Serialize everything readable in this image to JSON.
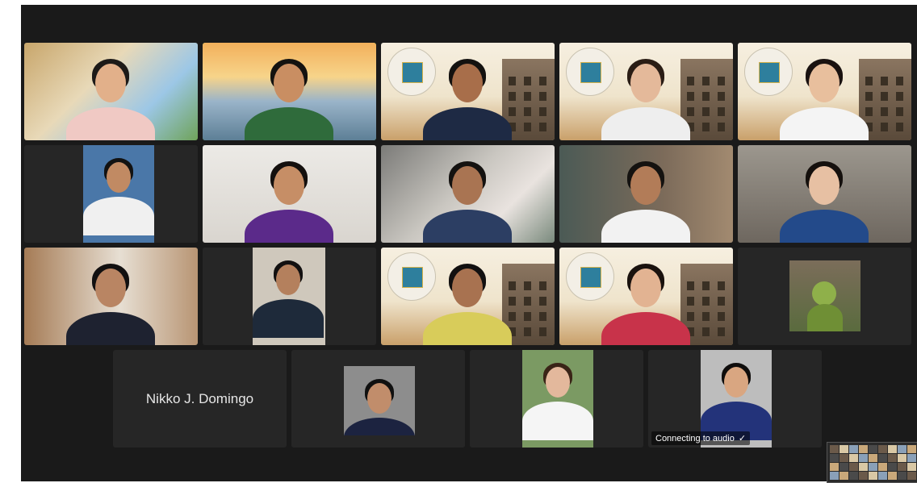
{
  "tiles": [
    {
      "id": "t1",
      "type": "video",
      "bg": "linear-gradient(135deg,#c8a66b 0%,#e8d9b8 40%,#9cc7e6 70%,#6fa35a 100%)",
      "skin": "#e2b08a",
      "shirt": "#f0c9c4",
      "hair": "#1d1a18",
      "active": false
    },
    {
      "id": "t2",
      "type": "video",
      "bg": "linear-gradient(180deg,#f2b05b 0%,#f7d48a 35%,#9ab4c9 60%,#5d7f96 100%)",
      "skin": "#c98e62",
      "shirt": "#2f6b3b",
      "hair": "#141210",
      "active": true
    },
    {
      "id": "t3",
      "type": "ust",
      "skin": "#a86e4a",
      "shirt": "#1e2a44",
      "hair": "#141210"
    },
    {
      "id": "t4",
      "type": "ust",
      "skin": "#e4b99a",
      "shirt": "#eeeeee",
      "hair": "#2a1d15"
    },
    {
      "id": "t5",
      "type": "ust",
      "skin": "#e8bf9d",
      "shirt": "#f4f4f4",
      "hair": "#1a1210"
    },
    {
      "id": "t6",
      "type": "portrait",
      "bg": "#4a77a8",
      "skin": "#c18a63",
      "shirt": "#f0f0f0",
      "hair": "#121212"
    },
    {
      "id": "t7",
      "type": "video",
      "bg": "linear-gradient(180deg,#eceae6,#d9d5cf)",
      "skin": "#c68e66",
      "shirt": "#5b2a8a",
      "hair": "#14100e"
    },
    {
      "id": "t8",
      "type": "video",
      "bg": "linear-gradient(135deg,#7b7b78 0%,#c9c6c0 45%,#e9e3df 70%,#7a8a7d 100%)",
      "skin": "#a97452",
      "shirt": "#2c3e63",
      "hair": "#141210"
    },
    {
      "id": "t9",
      "type": "video",
      "bg": "linear-gradient(90deg,#4b5a55 0%,#7c6b5a 60%,#a28a70 100%)",
      "skin": "#b27c58",
      "shirt": "#f2f2f2",
      "hair": "#141210"
    },
    {
      "id": "t10",
      "type": "video",
      "bg": "linear-gradient(180deg,#9c978e,#6e675f)",
      "skin": "#e7c0a3",
      "shirt": "#234a8a",
      "hair": "#15100d"
    },
    {
      "id": "t11",
      "type": "video",
      "bg": "linear-gradient(90deg,#a57b55 0%,#e7dfd3 55%,#b89574 100%)",
      "skin": "#b98563",
      "shirt": "#1e2230",
      "hair": "#121010"
    },
    {
      "id": "t12",
      "type": "portrait",
      "bg": "#cfc8bc",
      "skin": "#b4805d",
      "shirt": "#1e2a3a",
      "hair": "#121010"
    },
    {
      "id": "t13",
      "type": "ust",
      "skin": "#a87250",
      "shirt": "#d8cc5a",
      "hair": "#121010"
    },
    {
      "id": "t14",
      "type": "ust",
      "skin": "#e2b392",
      "shirt": "#c8334a",
      "hair": "#1a120e"
    },
    {
      "id": "t15",
      "type": "painting",
      "bg": "#6f6a4e"
    },
    {
      "id": "t16",
      "type": "name"
    },
    {
      "id": "t17",
      "type": "portrait",
      "bg": "#8d8d8d",
      "skin": "#c18d6b",
      "shirt": "#1c2340",
      "hair": "#101010"
    },
    {
      "id": "t18",
      "type": "portrait",
      "bg": "#7b9a63",
      "skin": "#e3b89c",
      "shirt": "#f5f5f5",
      "hair": "#3a2417"
    },
    {
      "id": "t19",
      "type": "portrait",
      "bg": "#bdbdbd",
      "skin": "#d9a681",
      "shirt": "#23337a",
      "hair": "#0f0d0c"
    }
  ],
  "name_tile": {
    "name": "Nikko J. Domingo"
  },
  "audio_status": {
    "text": "Connecting to audio"
  },
  "check_icon": "check-icon",
  "colors": {
    "active_border": "#3fcf4a",
    "stage": "#1a1a1a",
    "tile": "#262626"
  }
}
